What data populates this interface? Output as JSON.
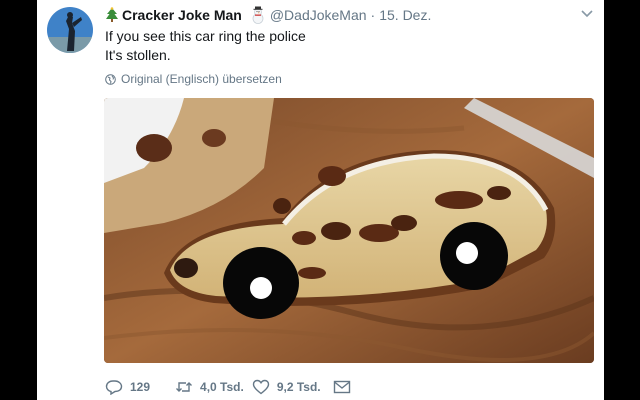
{
  "tweet": {
    "display_name": "Cracker Joke Man",
    "handle": "@DadJokeMan",
    "separator": "·",
    "date": "15. Dez.",
    "text_line1": "If you see this car ring the police",
    "text_line2": "It's stollen.",
    "translate_label": "Original (Englisch) übersetzen"
  },
  "actions": {
    "replies": "129",
    "retweets": "4,0 Tsd.",
    "likes": "9,2 Tsd."
  },
  "icons": {
    "name_prefix": "christmas-tree-icon",
    "name_suffix": "snowman-icon",
    "menu": "chevron-down-icon",
    "translate": "globe-icon",
    "reply": "reply-icon",
    "retweet": "retweet-icon",
    "like": "heart-icon",
    "message": "envelope-icon"
  },
  "colors": {
    "text": "#14171a",
    "secondary": "#657786",
    "background": "#ffffff"
  }
}
